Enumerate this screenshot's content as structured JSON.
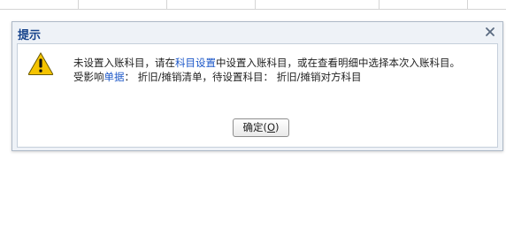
{
  "dialog": {
    "title": "提示",
    "close_label": "x",
    "message": {
      "line1_part1": "未设置入账科目，请在",
      "line1_link": "科目设置",
      "line1_part2": "中设置入账科目，或在查看明细中选择本次入账科目。",
      "line2_part1": "受影响",
      "line2_link": "单据",
      "line2_part2": "： 折旧/摊销清单，待设置科目： 折旧/摊销对方科目"
    },
    "ok_button": {
      "label_prefix": "确定(",
      "accelerator": "O",
      "label_suffix": ")"
    }
  },
  "colors": {
    "title_text": "#15428b",
    "link": "#1a56c8",
    "warning_fill": "#f5c400",
    "dialog_bg": "#eef2f7"
  },
  "icons": {
    "warning": "warning-icon",
    "close": "close-icon"
  }
}
